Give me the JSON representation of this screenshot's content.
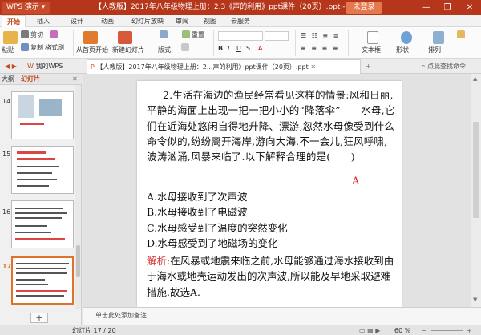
{
  "titlebar": {
    "app": "WPS 演示",
    "title": "【人教版】2017年八年级物理上册：2.3《声的利用》ppt课件（20页）.ppt - WPS 演示",
    "login": "未登录",
    "min": "—",
    "max": "❐",
    "close": "✕"
  },
  "menu": {
    "tabs": [
      "开始",
      "插入",
      "设计",
      "动画",
      "幻灯片放映",
      "审阅",
      "视图",
      "云服务"
    ]
  },
  "ribbon": {
    "paste": "粘贴",
    "cut": "剪切",
    "copy": "复制",
    "format_painter": "格式刷",
    "from_start": "从首页开始",
    "new_slide": "新建幻灯片",
    "layout": "版式",
    "reset": "重置",
    "textbox": "文本框",
    "shape": "形状",
    "arrange": "排列"
  },
  "doctabs": {
    "home": "我的WPS",
    "current": "【人教版】2017年八年级物理上册：2...声的利用》ppt课件（20页）.ppt",
    "search_hint": "点此查找命令"
  },
  "panel": {
    "outline_tab": "大纲",
    "slides_tab": "幻灯片",
    "slide_numbers": [
      "14",
      "15",
      "16",
      "17"
    ],
    "add_slide": "+"
  },
  "slide": {
    "stem": "2.生活在海边的渔民经常看见这样的情景:风和日丽,平静的海面上出现一把一把小小的“降落伞”——水母,它们在近海处悠闲自得地升降、漂游,忽然水母像受到什么命令似的,纷纷离开海岸,游向大海.不一会儿,狂风呼啸,波涛汹涌,风暴来临了.以下解释合理的是(　　)",
    "hand_answer": "A",
    "options": [
      "A.水母接收到了次声波",
      "B.水母接收到了电磁波",
      "C.水母感受到了温度的突然变化",
      "D.水母感受到了地磁场的变化"
    ],
    "analysis_label": "解析:",
    "analysis_text": "在风暴或地震来临之前,水母能够通过海水接收到由于海水或地壳运动发出的次声波,所以能及早地采取避难措施.故选A."
  },
  "notes": {
    "placeholder": "单击此处添加备注"
  },
  "status": {
    "slide_count": "幻灯片 17 / 20",
    "zoom": "60 %"
  },
  "colors": {
    "titlebar": "#b5361b",
    "accent": "#c24b22",
    "analysis_label": "#d43c3c",
    "hand_answer": "#e02020"
  }
}
